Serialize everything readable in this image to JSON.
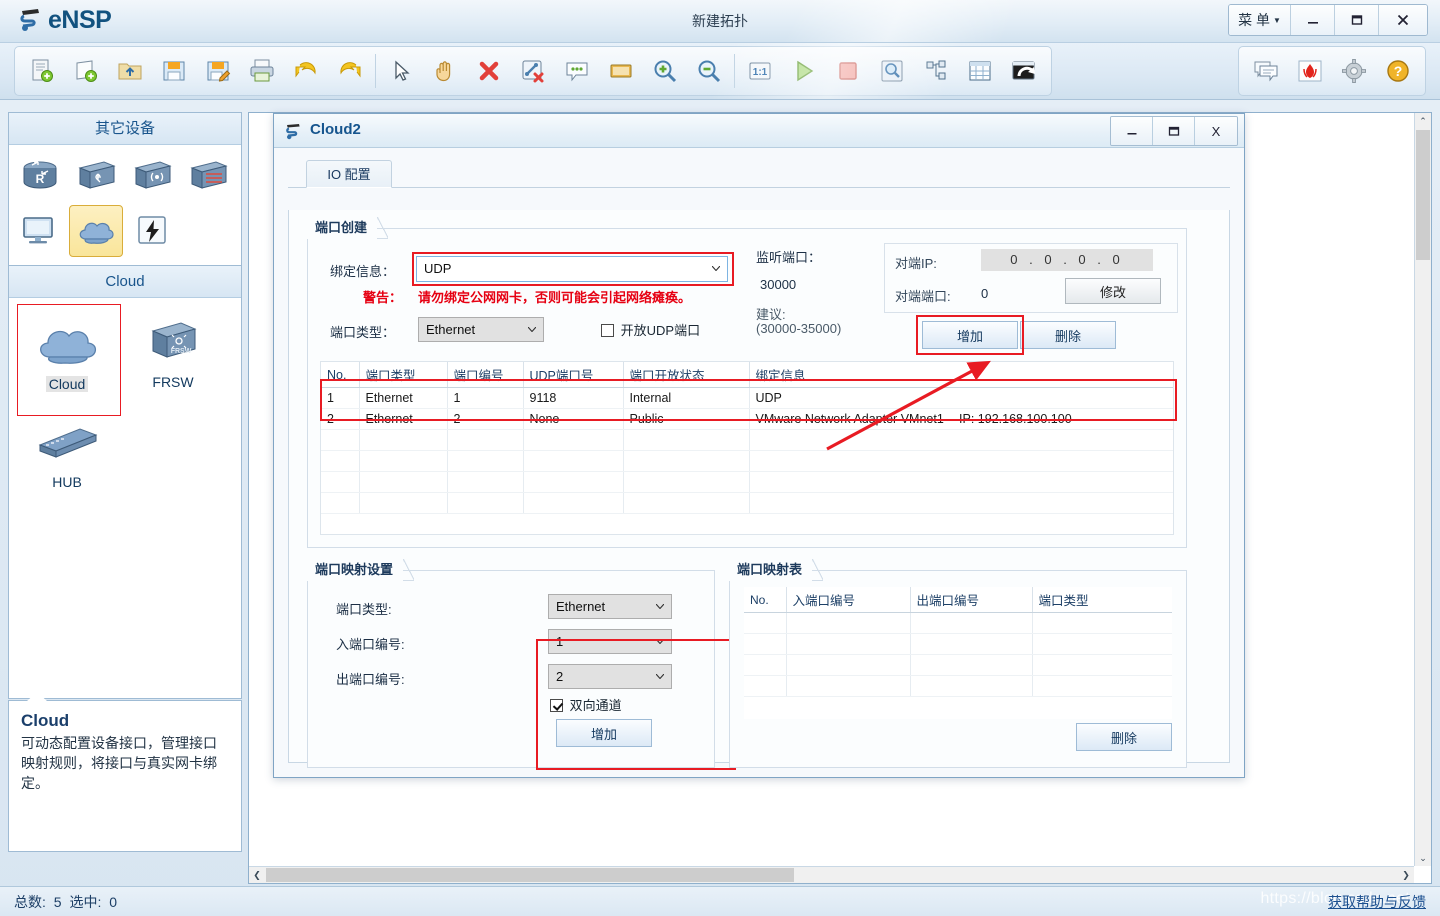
{
  "app": {
    "brand": "eNSP",
    "window_title": "新建拓扑",
    "menu_label": "菜 单",
    "minimize": "–",
    "maximize": "❐",
    "close": "✕"
  },
  "toolbar": {
    "left_buttons": [
      {
        "name": "new-topology-icon",
        "tip": "新建"
      },
      {
        "name": "new-device-icon",
        "tip": "新建设备"
      },
      {
        "name": "open-folder-icon",
        "tip": "打开"
      },
      {
        "name": "save-icon",
        "tip": "保存"
      },
      {
        "name": "save-as-icon",
        "tip": "另存为"
      },
      {
        "name": "print-icon",
        "tip": "打印"
      },
      {
        "name": "undo-icon",
        "tip": "撤销"
      },
      {
        "name": "redo-icon",
        "tip": "重做"
      },
      {
        "name": "pointer-icon",
        "tip": "选择"
      },
      {
        "name": "hand-icon",
        "tip": "移动"
      },
      {
        "name": "delete-icon",
        "tip": "删除"
      },
      {
        "name": "delete-link-icon",
        "tip": "删除连线"
      },
      {
        "name": "comment-icon",
        "tip": "批注"
      },
      {
        "name": "shape-icon",
        "tip": "图形"
      },
      {
        "name": "zoom-in-icon",
        "tip": "放大"
      },
      {
        "name": "zoom-out-icon",
        "tip": "缩小"
      },
      {
        "name": "zoom-reset-icon",
        "tip": "1:1"
      },
      {
        "name": "start-icon",
        "tip": "开启设备"
      },
      {
        "name": "stop-icon",
        "tip": "关闭设备"
      },
      {
        "name": "capture-icon",
        "tip": "数据抓包"
      },
      {
        "name": "topology-tree-icon",
        "tip": "拓扑树"
      },
      {
        "name": "grid-icon",
        "tip": "网格"
      },
      {
        "name": "restore-icon",
        "tip": "恢复"
      }
    ],
    "right_buttons": [
      {
        "name": "feedback-icon",
        "tip": "反馈"
      },
      {
        "name": "huawei-icon",
        "tip": "华为"
      },
      {
        "name": "settings-gear-icon",
        "tip": "设置"
      },
      {
        "name": "help-icon",
        "tip": "帮助"
      }
    ]
  },
  "sidebar": {
    "category_title": "其它设备",
    "device_types": [
      {
        "name": "router-icon",
        "label": "路由器"
      },
      {
        "name": "switch-icon",
        "label": "交换机"
      },
      {
        "name": "wlan-icon",
        "label": "WLAN"
      },
      {
        "name": "firewall-icon",
        "label": "防火墙"
      },
      {
        "name": "pc-icon",
        "label": "终端"
      },
      {
        "name": "cloud-icon",
        "label": "其它设备",
        "selected": true
      },
      {
        "name": "lightning-icon",
        "label": "自定义"
      }
    ],
    "model_title": "Cloud",
    "models": [
      {
        "label": "Cloud",
        "icon": "cloud-icon",
        "selected": true
      },
      {
        "label": "FRSW",
        "icon": "frsw-icon",
        "selected": false
      },
      {
        "label": "HUB",
        "icon": "hub-icon",
        "selected": false
      }
    ],
    "tooltip": {
      "title": "Cloud",
      "body": "可动态配置设备接口，管理接口映射规则，将接口与真实网卡绑定。"
    }
  },
  "dialog": {
    "title": "Cloud2",
    "minimize": "_",
    "maximize": "❐",
    "close": "X",
    "tab": "IO 配置",
    "port_create": {
      "legend": "端口创建",
      "binding_label": "绑定信息：",
      "binding_value": "UDP",
      "warn_label": "警告：",
      "warn_text": "请勿绑定公网网卡，否则可能会引起网络瘫痪。",
      "port_type_label": "端口类型：",
      "port_type_value": "Ethernet",
      "open_udp_label": "开放UDP端口",
      "open_udp_checked": false,
      "listen_port_label": "监听端口：",
      "listen_port_value": "30000",
      "suggest_label": "建议:",
      "suggest_range": "(30000-35000)",
      "peer_ip_label": "对端IP:",
      "peer_ip_value": "0 . 0 . 0 . 0",
      "peer_port_label": "对端端口:",
      "peer_port_value": "0",
      "modify_button": "修改",
      "add_button": "增加",
      "delete_button": "删除"
    },
    "port_table": {
      "headers": [
        "No.",
        "端口类型",
        "端口编号",
        "UDP端口号",
        "端口开放状态",
        "绑定信息"
      ],
      "rows": [
        [
          "1",
          "Ethernet",
          "1",
          "9118",
          "Internal",
          "UDP"
        ],
        [
          "2",
          "Ethernet",
          "2",
          "None",
          "Public",
          "VMware Network Adapter VMnet1 -- IP: 192.168.100.100"
        ]
      ],
      "empty_rows": 4
    },
    "port_mapping_settings": {
      "legend": "端口映射设置",
      "port_type_label": "端口类型:",
      "port_type_value": "Ethernet",
      "in_port_label": "入端口编号:",
      "in_port_value": "1",
      "out_port_label": "出端口编号:",
      "out_port_value": "2",
      "bidirectional_label": "双向通道",
      "bidirectional_checked": true,
      "add_button": "增加"
    },
    "port_mapping_table": {
      "legend": "端口映射表",
      "headers": [
        "No.",
        "入端口编号",
        "出端口编号",
        "端口类型"
      ],
      "rows": [],
      "empty_rows": 4,
      "delete_button": "删除"
    }
  },
  "statusbar": {
    "total_label": "总数:",
    "total_value": "5",
    "selected_label": "选中:",
    "selected_value": "0",
    "help_link": "获取帮助与反馈",
    "watermark": "https://blog.csdn.net"
  },
  "colors": {
    "accent": "#16558e",
    "warning": "#e60012",
    "annotation": "#e81b23",
    "panel_border": "#9fbbd4"
  }
}
